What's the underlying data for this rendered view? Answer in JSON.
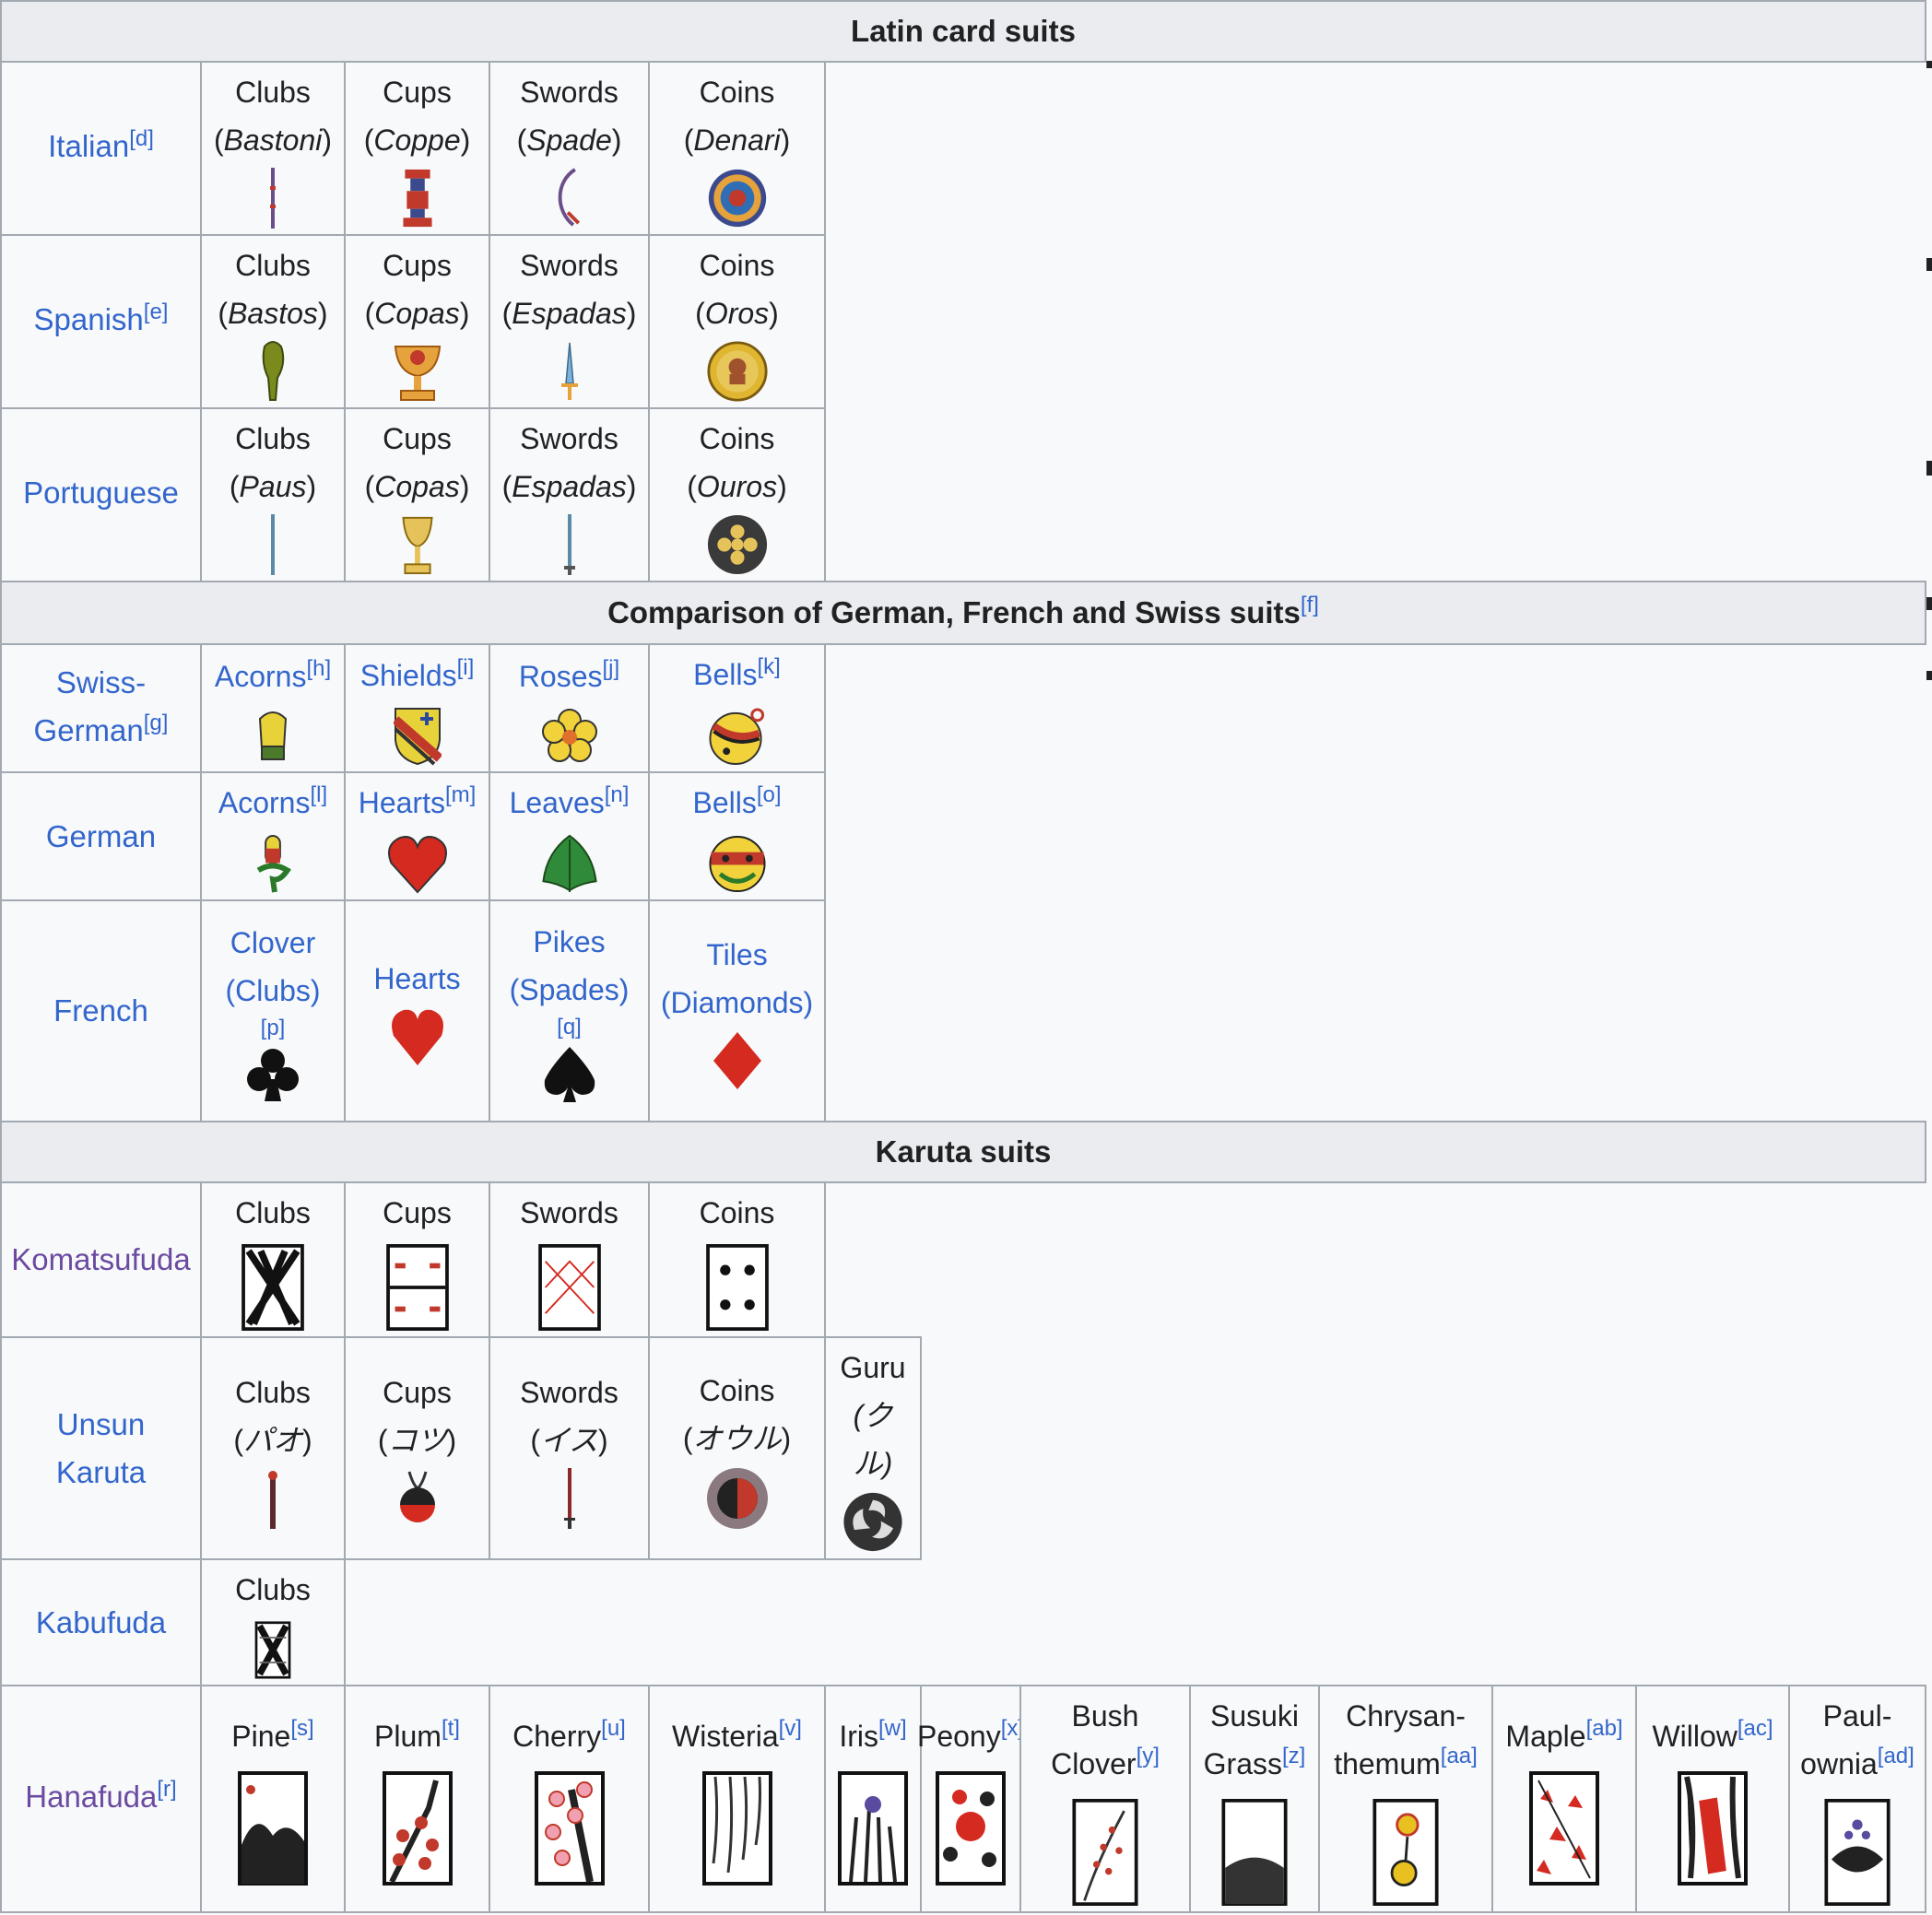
{
  "sections": {
    "latin": {
      "title": "Latin card suits"
    },
    "gfs": {
      "title": "Comparison of German, French and Swiss suits",
      "note": "[f]"
    },
    "karuta": {
      "title": "Karuta suits"
    }
  },
  "latin_rows": [
    {
      "name": "Italian",
      "note": "[d]",
      "cells": [
        {
          "label": "Clubs",
          "local": "Bastoni",
          "icon": "italian-club-icon"
        },
        {
          "label": "Cups",
          "local": "Coppe",
          "icon": "italian-cup-icon"
        },
        {
          "label": "Swords",
          "local": "Spade",
          "icon": "italian-sword-icon"
        },
        {
          "label": "Coins",
          "local": "Denari",
          "icon": "italian-coin-icon"
        }
      ]
    },
    {
      "name": "Spanish",
      "note": "[e]",
      "cells": [
        {
          "label": "Clubs",
          "local": "Bastos",
          "icon": "spanish-club-icon"
        },
        {
          "label": "Cups",
          "local": "Copas",
          "icon": "spanish-cup-icon"
        },
        {
          "label": "Swords",
          "local": "Espadas",
          "icon": "spanish-sword-icon"
        },
        {
          "label": "Coins",
          "local": "Oros",
          "icon": "spanish-coin-icon"
        }
      ]
    },
    {
      "name": "Portuguese",
      "note": "",
      "cells": [
        {
          "label": "Clubs",
          "local": "Paus",
          "icon": "portuguese-club-icon"
        },
        {
          "label": "Cups",
          "local": "Copas",
          "icon": "portuguese-cup-icon"
        },
        {
          "label": "Swords",
          "local": "Espadas",
          "icon": "portuguese-sword-icon"
        },
        {
          "label": "Coins",
          "local": "Ouros",
          "icon": "portuguese-coin-icon"
        }
      ]
    }
  ],
  "gfs_rows": [
    {
      "name1": "Swiss-",
      "name2": "German",
      "note": "[g]",
      "cells": [
        {
          "label": "Acorns",
          "note": "[h]",
          "icon": "swiss-acorn-icon"
        },
        {
          "label": "Shields",
          "note": "[i]",
          "icon": "shield-icon"
        },
        {
          "label": "Roses",
          "note": "[j]",
          "icon": "rose-icon"
        },
        {
          "label": "Bells",
          "note": "[k]",
          "icon": "swiss-bell-icon"
        }
      ]
    },
    {
      "name": "German",
      "note": "",
      "cells": [
        {
          "label": "Acorns",
          "note": "[l]",
          "icon": "german-acorn-icon"
        },
        {
          "label": "Hearts",
          "note": "[m]",
          "icon": "german-heart-icon"
        },
        {
          "label": "Leaves",
          "note": "[n]",
          "icon": "leaf-icon"
        },
        {
          "label": "Bells",
          "note": "[o]",
          "icon": "german-bell-icon"
        }
      ]
    },
    {
      "name": "French",
      "cells": [
        {
          "l1": "Clover",
          "l2": "(Clubs)",
          "note": "[p]",
          "icon": "club-icon"
        },
        {
          "l1": "Hearts",
          "l2": "",
          "note": "",
          "icon": "heart-icon"
        },
        {
          "l1": "Pikes",
          "l2": "(Spades)",
          "note": "[q]",
          "icon": "spade-icon"
        },
        {
          "l1": "Tiles",
          "l2": "(Diamonds)",
          "note": "",
          "icon": "diamond-icon"
        }
      ]
    }
  ],
  "karuta_rows": {
    "komatsufuda": {
      "name": "Komatsufuda",
      "cells": [
        "Clubs",
        "Cups",
        "Swords",
        "Coins"
      ]
    },
    "unsun": {
      "name1": "Unsun",
      "name2": "Karuta",
      "cells": [
        {
          "label": "Clubs",
          "local": "パオ"
        },
        {
          "label": "Cups",
          "local": "コツ"
        },
        {
          "label": "Swords",
          "local": "イス"
        },
        {
          "label": "Coins",
          "local": "オウル"
        },
        {
          "label": "Guru",
          "local1": "(ク",
          "local2": "ル)"
        }
      ]
    },
    "kabufuda": {
      "name": "Kabufuda",
      "cells": [
        "Clubs"
      ]
    },
    "hanafuda": {
      "name": "Hanafuda",
      "note": "[r]",
      "cells": [
        {
          "l1": "",
          "l2": "Pine",
          "note": "[s]"
        },
        {
          "l1": "",
          "l2": "Plum",
          "note": "[t]"
        },
        {
          "l1": "",
          "l2": "Cherry",
          "note": "[u]"
        },
        {
          "l1": "",
          "l2": "Wisteria",
          "note": "[v]"
        },
        {
          "l1": "",
          "l2": "Iris",
          "note": "[w]"
        },
        {
          "l1": "",
          "l2": "Peony",
          "note": "[x]"
        },
        {
          "l1": "Bush",
          "l2": "Clover",
          "note": "[y]"
        },
        {
          "l1": "Susuki",
          "l2": "Grass",
          "note": "[z]"
        },
        {
          "l1": "Chrysan-",
          "l2": "themum",
          "note": "[aa]"
        },
        {
          "l1": "",
          "l2": "Maple",
          "note": "[ab]"
        },
        {
          "l1": "",
          "l2": "Willow",
          "note": "[ac]"
        },
        {
          "l1": "Paul-",
          "l2": "ownia",
          "note": "[ad]"
        }
      ]
    }
  },
  "colors": {
    "link": "#3366cc",
    "visited": "#6b4ba1",
    "header_bg": "#eaecf0",
    "border": "#a2a9b1"
  }
}
